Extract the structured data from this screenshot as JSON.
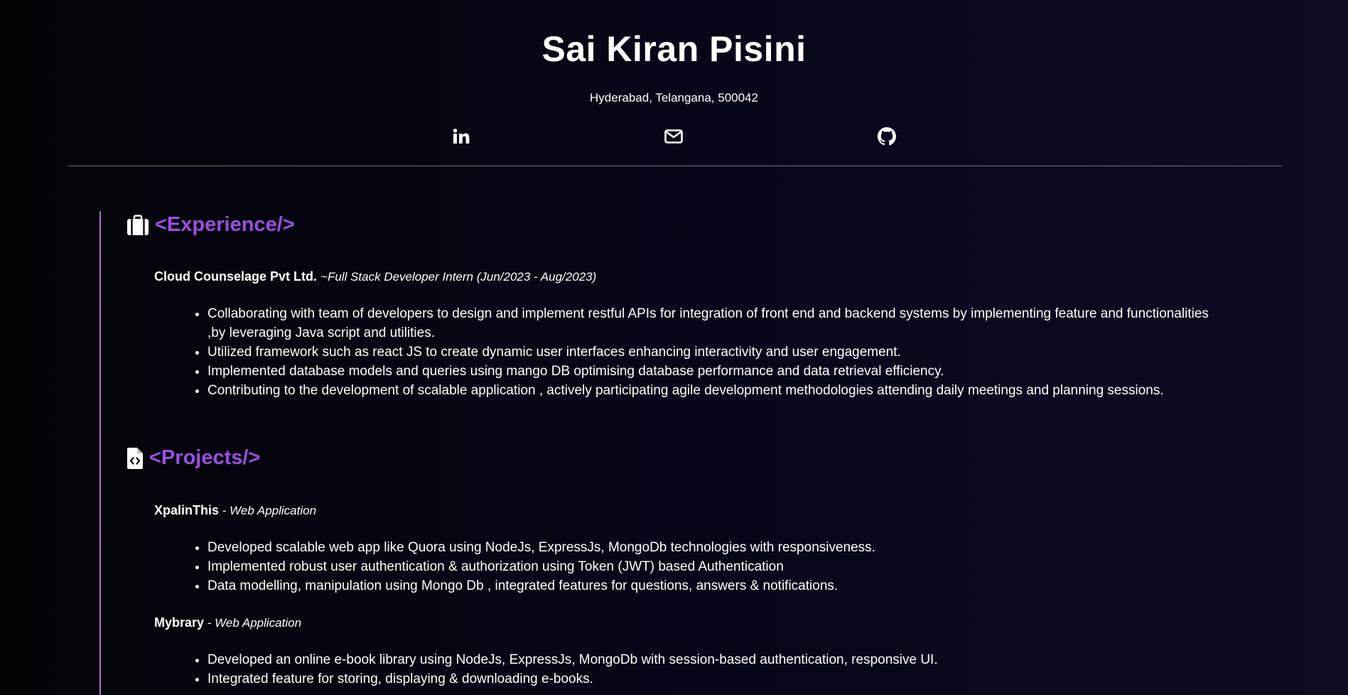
{
  "header": {
    "name": "Sai Kiran Pisini",
    "address": "Hyderabad, Telangana, 500042",
    "social": [
      {
        "icon": "linkedin-icon"
      },
      {
        "icon": "mail-icon"
      },
      {
        "icon": "github-icon"
      }
    ]
  },
  "colors": {
    "accent": "#9b4fe0",
    "timeline": "#b56ad6",
    "background": "#05050f",
    "text": "#ffffff"
  },
  "experience": {
    "icon": "briefcase-icon",
    "heading": "<Experience/>",
    "entries": [
      {
        "company": "Cloud Counselage Pvt Ltd.",
        "role": "~Full Stack Developer Intern (Jun/2023 - Aug/2023)",
        "bullets": [
          "Collaborating with team of developers to design and implement restful APIs for integration of front end and backend systems by implementing feature and functionalities ,by leveraging Java script and utilities.",
          "Utilized framework such as react JS to create dynamic user interfaces enhancing interactivity and user engagement.",
          "Implemented database models and queries using mango DB optimising database performance and data retrieval efficiency.",
          "Contributing to the development of scalable application , actively participating agile development methodologies attending daily meetings and planning sessions."
        ]
      }
    ]
  },
  "projects": {
    "icon": "file-code-icon",
    "heading": "<Projects/>",
    "entries": [
      {
        "name": "XpalinThis",
        "type": " - Web Application",
        "bullets": [
          "Developed scalable web app like Quora using NodeJs, ExpressJs, MongoDb technologies with responsiveness.",
          "Implemented robust user authentication & authorization using Token (JWT) based Authentication",
          "Data modelling, manipulation using Mongo Db , integrated features for questions, answers & notifications."
        ]
      },
      {
        "name": "Mybrary",
        "type": " - Web Application",
        "bullets": [
          "Developed an online e-book library using NodeJs, ExpressJs, MongoDb with session-based authentication, responsive UI.",
          "Integrated feature for storing, displaying & downloading e-books."
        ]
      }
    ]
  }
}
